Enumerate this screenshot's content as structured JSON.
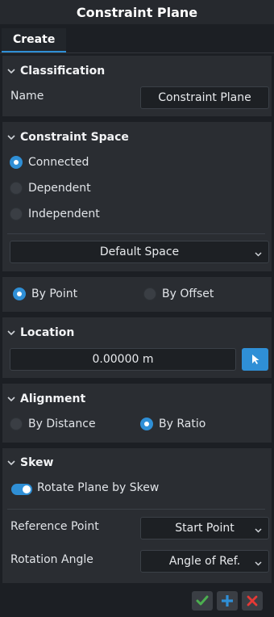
{
  "window": {
    "title": "Constraint Plane"
  },
  "tabs": [
    {
      "label": "Create"
    }
  ],
  "classification": {
    "title": "Classification",
    "name_label": "Name",
    "name_value": "Constraint Plane"
  },
  "constraint_space": {
    "title": "Constraint Space",
    "options": [
      {
        "label": "Connected",
        "selected": true
      },
      {
        "label": "Dependent",
        "selected": false
      },
      {
        "label": "Independent",
        "selected": false
      }
    ],
    "space_select": "Default Space"
  },
  "by_mode": {
    "options": [
      {
        "label": "By Point",
        "selected": true
      },
      {
        "label": "By Offset",
        "selected": false
      }
    ]
  },
  "location": {
    "title": "Location",
    "value": "0.00000 m"
  },
  "alignment": {
    "title": "Alignment",
    "options": [
      {
        "label": "By Distance",
        "selected": false
      },
      {
        "label": "By Ratio",
        "selected": true
      }
    ]
  },
  "skew": {
    "title": "Skew",
    "toggle_label": "Rotate Plane by Skew",
    "toggle_on": true,
    "reference_point_label": "Reference Point",
    "reference_point_value": "Start Point",
    "rotation_angle_label": "Rotation Angle",
    "rotation_angle_value": "Angle of Ref."
  },
  "colors": {
    "accent": "#2f8fd6",
    "ok": "#4caf50",
    "add": "#2f8fd6",
    "cancel": "#e53935"
  }
}
